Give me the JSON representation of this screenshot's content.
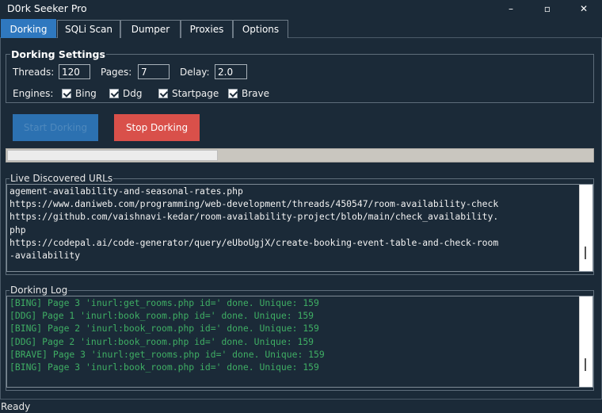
{
  "window": {
    "title": "D0rk Seeker Pro",
    "minimize_glyph": "–",
    "maximize_glyph": "▫",
    "close_glyph": "✕"
  },
  "tabs": [
    {
      "label": "Dorking",
      "active": true
    },
    {
      "label": "SQLi Scan",
      "active": false
    },
    {
      "label": "Dumper",
      "active": false
    },
    {
      "label": "Proxies",
      "active": false
    },
    {
      "label": "Options",
      "active": false
    }
  ],
  "settings": {
    "title": "Dorking Settings",
    "threads_label": "Threads:",
    "threads_value": "120",
    "pages_label": "Pages:",
    "pages_value": "7",
    "delay_label": "Delay:",
    "delay_value": "2.0",
    "engines_label": "Engines:",
    "engines": [
      {
        "label": "Bing",
        "checked": true
      },
      {
        "label": "Ddg",
        "checked": true
      },
      {
        "label": "Startpage",
        "checked": true
      },
      {
        "label": "Brave",
        "checked": true
      }
    ]
  },
  "actions": {
    "start_label": "Start Dorking",
    "stop_label": "Stop Dorking"
  },
  "progress": {
    "fraction": 0.36
  },
  "urls": {
    "title": "Live Discovered URLs",
    "lines": [
      "agement-availability-and-seasonal-rates.php",
      "https://www.daniweb.com/programming/web-development/threads/450547/room-availability-check",
      "https://github.com/vaishnavi-kedar/room-availability-project/blob/main/check_availability.",
      "php",
      "https://codepal.ai/code-generator/query/eUboUgjX/create-booking-event-table-and-check-room",
      "-availability"
    ]
  },
  "log": {
    "title": "Dorking Log",
    "lines": [
      "[BING] Page 3 'inurl:get_rooms.php id=' done. Unique: 159",
      "[DDG] Page 1 'inurl:book_room.php id=' done. Unique: 159",
      "[BING] Page 2 'inurl:book_room.php id=' done. Unique: 159",
      "[DDG] Page 2 'inurl:book_room.php id=' done. Unique: 159",
      "[BRAVE] Page 3 'inurl:get_rooms.php id=' done. Unique: 159",
      "[BING] Page 3 'inurl:book_room.php id=' done. Unique: 159"
    ]
  },
  "status": {
    "text": "Ready"
  },
  "colors": {
    "background": "#1b2a38",
    "accent": "#2f78bf",
    "stop_button": "#d9504a",
    "log_text": "#3fae64"
  }
}
